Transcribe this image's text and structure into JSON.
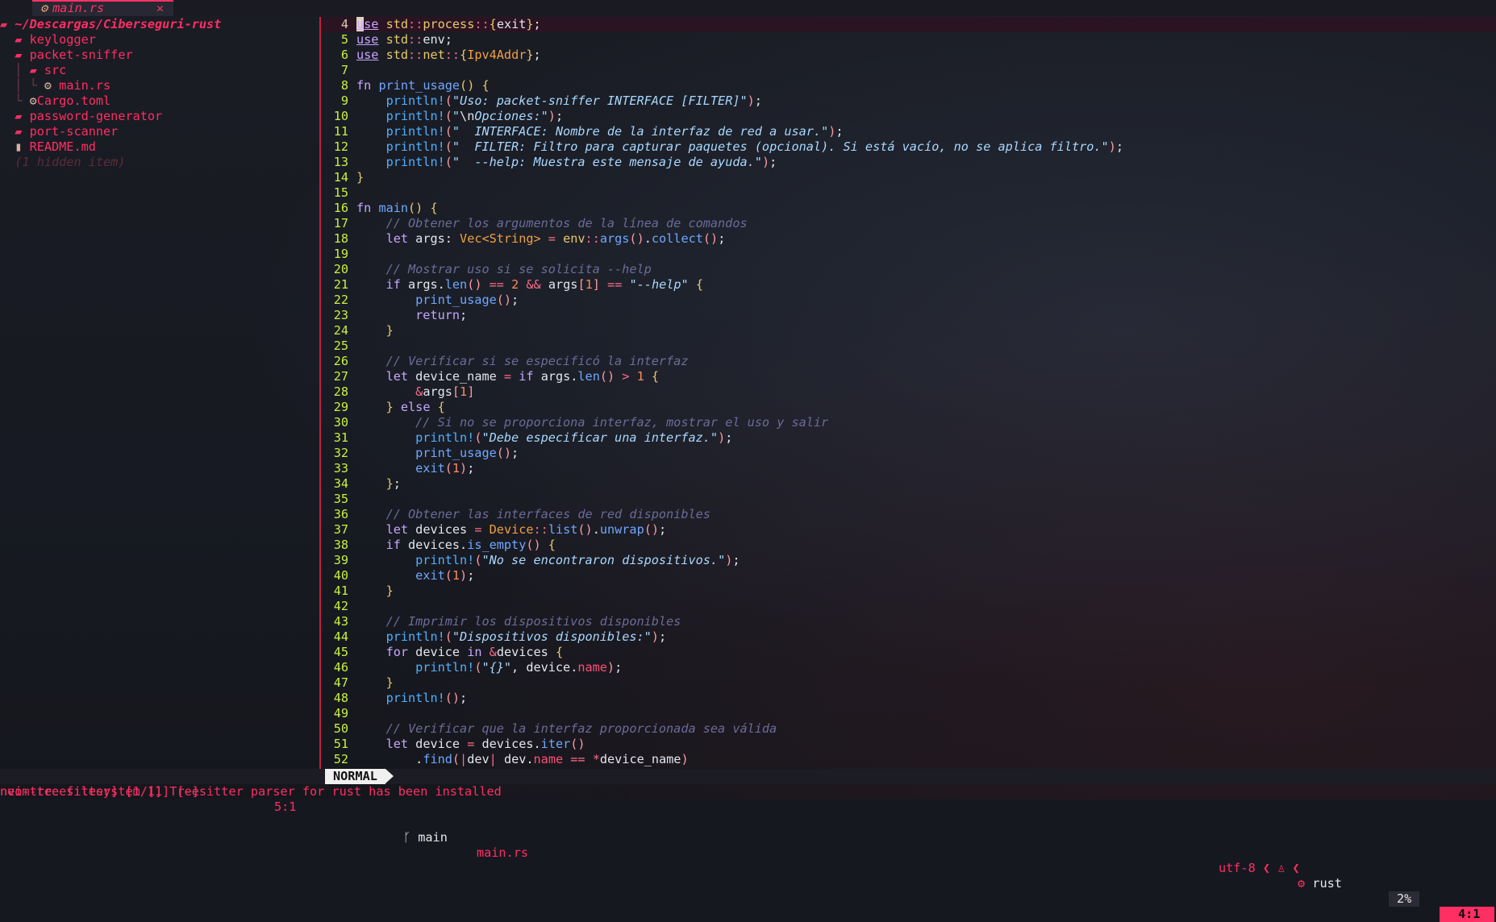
{
  "tabline": {
    "tab_icon": "rust-icon",
    "tab_label": "main.rs",
    "close_symbol": "✕"
  },
  "tree": {
    "root": "~/Descargas/Ciberseguri-rust",
    "items": [
      {
        "label": "keylogger",
        "icon": "folder-icon"
      },
      {
        "label": "packet-sniffer",
        "icon": "folder-open-icon"
      },
      {
        "label": "src",
        "icon": "folder-icon"
      },
      {
        "label": "main.rs",
        "icon": "rust-icon"
      },
      {
        "label": "Cargo.toml",
        "icon": "gear-icon"
      },
      {
        "label": "password-generator",
        "icon": "folder-icon"
      },
      {
        "label": "port-scanner",
        "icon": "folder-icon"
      },
      {
        "label": "README.md",
        "icon": "file-icon"
      }
    ],
    "hidden": "(1 hidden item)"
  },
  "editor": {
    "line_numbers": [
      "4",
      "5",
      "6",
      "7",
      "8",
      "9",
      "10",
      "11",
      "12",
      "13",
      "14",
      "15",
      "16",
      "17",
      "18",
      "19",
      "20",
      "21",
      "22",
      "23",
      "24",
      "25",
      "26",
      "27",
      "28",
      "29",
      "30",
      "31",
      "32",
      "33",
      "34",
      "35",
      "36",
      "37",
      "38",
      "39",
      "40",
      "41",
      "42",
      "43",
      "44",
      "45",
      "46",
      "47",
      "48",
      "49",
      "50",
      "51",
      "52"
    ],
    "lines": [
      "use std::process::{exit};",
      "use std::env;",
      "use std::net::{Ipv4Addr};",
      "",
      "fn print_usage() {",
      "    println!(\"Uso: packet-sniffer INTERFACE [FILTER]\");",
      "    println!(\"\\nOpciones:\");",
      "    println!(\"  INTERFACE: Nombre de la interfaz de red a usar.\");",
      "    println!(\"  FILTER: Filtro para capturar paquetes (opcional). Si está vacío, no se aplica filtro.\");",
      "    println!(\"  --help: Muestra este mensaje de ayuda.\");",
      "}",
      "",
      "fn main() {",
      "    // Obtener los argumentos de la línea de comandos",
      "    let args: Vec<String> = env::args().collect();",
      "",
      "    // Mostrar uso si se solicita --help",
      "    if args.len() == 2 && args[1] == \"--help\" {",
      "        print_usage();",
      "        return;",
      "    }",
      "",
      "    // Verificar si se especificó la interfaz",
      "    let device_name = if args.len() > 1 {",
      "        &args[1]",
      "    } else {",
      "        // Si no se proporciona interfaz, mostrar el uso y salir",
      "        println!(\"Debe especificar una interfaz.\");",
      "        print_usage();",
      "        exit(1);",
      "    };",
      "",
      "    // Obtener las interfaces de red disponibles",
      "    let devices = Device::list().unwrap();",
      "    if devices.is_empty() {",
      "        println!(\"No se encontraron dispositivos.\");",
      "        exit(1);",
      "    }",
      "",
      "    // Imprimir los dispositivos disponibles",
      "    println!(\"Dispositivos disponibles:\");",
      "    for device in &devices {",
      "        println!(\"{}\", device.name);",
      "    }",
      "    println!();",
      "",
      "    // Verificar que la interfaz proporcionada sea válida",
      "    let device = devices.iter()",
      "        .find(|dev| dev.name == *device_name)"
    ]
  },
  "status": {
    "left": "neo-tree filesystem [1] [-]",
    "left_pos": "5:1",
    "mode": "NORMAL",
    "branch_icon": "git-branch-icon",
    "branch": "main",
    "file": "main.rs",
    "encoding": "utf-8",
    "os_icon": "linux-icon",
    "lang_icon": "rust-icon",
    "language": "rust",
    "percent": "2%",
    "cursor": "4:1"
  },
  "message": "nvim-treesitter] [1/1] Treesitter parser for rust has been installed"
}
